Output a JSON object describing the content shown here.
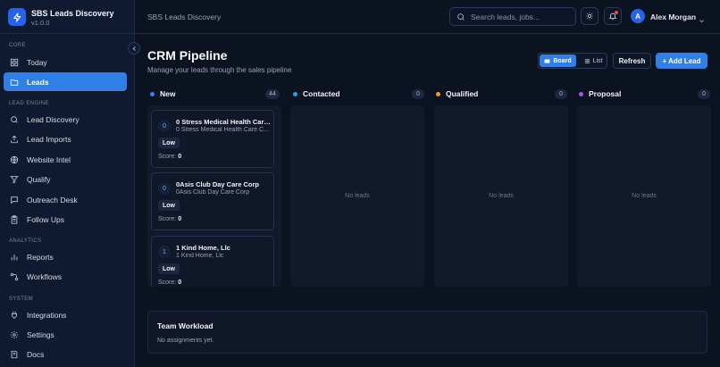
{
  "brand": {
    "title": "SBS Leads Discovery",
    "version": "v1.0.0"
  },
  "sidebar": {
    "sections": [
      {
        "label": "Core",
        "items": [
          {
            "label": "Today",
            "icon": "grid-icon",
            "active": false
          },
          {
            "label": "Leads",
            "icon": "folder-icon",
            "active": true
          }
        ]
      },
      {
        "label": "Lead Engine",
        "items": [
          {
            "label": "Lead Discovery",
            "icon": "search-icon",
            "active": false
          },
          {
            "label": "Lead Imports",
            "icon": "upload-icon",
            "active": false
          },
          {
            "label": "Website Intel",
            "icon": "globe-icon",
            "active": false
          },
          {
            "label": "Qualify",
            "icon": "funnel-icon",
            "active": false
          },
          {
            "label": "Outreach Desk",
            "icon": "message-icon",
            "active": false
          },
          {
            "label": "Follow Ups",
            "icon": "clipboard-icon",
            "active": false
          }
        ]
      },
      {
        "label": "Analytics",
        "items": [
          {
            "label": "Reports",
            "icon": "bar-chart-icon",
            "active": false
          },
          {
            "label": "Workflows",
            "icon": "workflow-icon",
            "active": false
          }
        ]
      },
      {
        "label": "System",
        "items": [
          {
            "label": "Integrations",
            "icon": "plug-icon",
            "active": false
          },
          {
            "label": "Settings",
            "icon": "gear-icon",
            "active": false
          },
          {
            "label": "Docs",
            "icon": "book-icon",
            "active": false
          }
        ]
      }
    ]
  },
  "topbar": {
    "breadcrumb": "SBS Leads Discovery",
    "search_placeholder": "Search leads, jobs...",
    "user": {
      "initial": "A",
      "name": "Alex Morgan"
    }
  },
  "page": {
    "title": "CRM Pipeline",
    "subtitle": "Manage your leads through the sales pipeline",
    "view_board": "Board",
    "view_list": "List",
    "refresh": "Refresh",
    "add_lead": "+ Add Lead"
  },
  "columns": [
    {
      "name": "New",
      "count": "44",
      "color": "#3b82f6",
      "cards": [
        {
          "num": "0",
          "name": "0 Stress Medical Health Care ...",
          "sub": "0 Stress Medical Health Care C...",
          "priority": "Low",
          "score": "0"
        },
        {
          "num": "0",
          "name": "0Asis Club Day Care Corp",
          "sub": "0Asis Club Day Care Corp",
          "priority": "Low",
          "score": "0"
        },
        {
          "num": "1",
          "name": "1 Kind Home, Llc",
          "sub": "1 Kind Home, Llc",
          "priority": "Low",
          "score": "0"
        }
      ]
    },
    {
      "name": "Contacted",
      "count": "0",
      "color": "#22a3e6",
      "empty": "No leads"
    },
    {
      "name": "Qualified",
      "count": "0",
      "color": "#f59e0b",
      "empty": "No leads"
    },
    {
      "name": "Proposal",
      "count": "0",
      "color": "#a855f7",
      "empty": "No leads"
    }
  ],
  "score_label": "Score:",
  "workload": {
    "title": "Team Workload",
    "empty": "No assignments yet."
  }
}
